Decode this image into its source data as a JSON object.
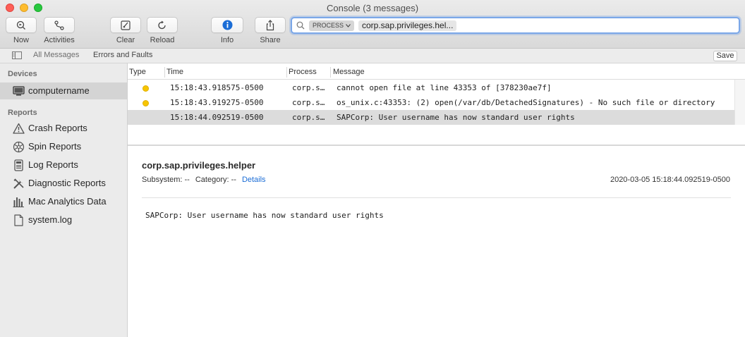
{
  "window": {
    "title": "Console (3 messages)"
  },
  "toolbar": {
    "now": "Now",
    "activities": "Activities",
    "clear": "Clear",
    "reload": "Reload",
    "info": "Info",
    "share": "Share"
  },
  "search": {
    "token_label": "PROCESS",
    "value": "corp.sap.privileges.hel..."
  },
  "filterbar": {
    "all_messages": "All Messages",
    "errors_faults": "Errors and Faults",
    "save": "Save"
  },
  "sidebar": {
    "devices_header": "Devices",
    "device": "computername",
    "reports_header": "Reports",
    "reports": [
      {
        "label": "Crash Reports",
        "icon": "warning-triangle-icon"
      },
      {
        "label": "Spin Reports",
        "icon": "spinner-wheel-icon"
      },
      {
        "label": "Log Reports",
        "icon": "log-document-icon"
      },
      {
        "label": "Diagnostic Reports",
        "icon": "tools-icon"
      },
      {
        "label": "Mac Analytics Data",
        "icon": "bar-graph-icon"
      },
      {
        "label": "system.log",
        "icon": "document-icon"
      }
    ]
  },
  "table": {
    "columns": {
      "type": "Type",
      "time": "Time",
      "process": "Process",
      "message": "Message"
    },
    "rows": [
      {
        "has_dot": true,
        "time": "15:18:43.918575-0500",
        "process": "corp.s…",
        "message": "cannot open file at line 43353 of [378230ae7f]"
      },
      {
        "has_dot": true,
        "time": "15:18:43.919275-0500",
        "process": "corp.s…",
        "message": "os_unix.c:43353: (2) open(/var/db/DetachedSignatures) - No such file or directory"
      },
      {
        "has_dot": false,
        "time": "15:18:44.092519-0500",
        "process": "corp.s…",
        "message": "SAPCorp: User username has now standard user rights"
      }
    ],
    "selected_row": 2
  },
  "detail": {
    "process": "corp.sap.privileges.helper",
    "subsystem": "Subsystem: --",
    "category": "Category: --",
    "details_link": "Details",
    "date": "2020-03-05 15:18:44.092519-0500",
    "message": "SAPCorp: User username has now standard user rights"
  },
  "colors": {
    "warning_dot": "#f7c500",
    "link": "#1b6dd6",
    "search_focus": "#7aa7e8",
    "info_icon": "#1b6dd6"
  }
}
